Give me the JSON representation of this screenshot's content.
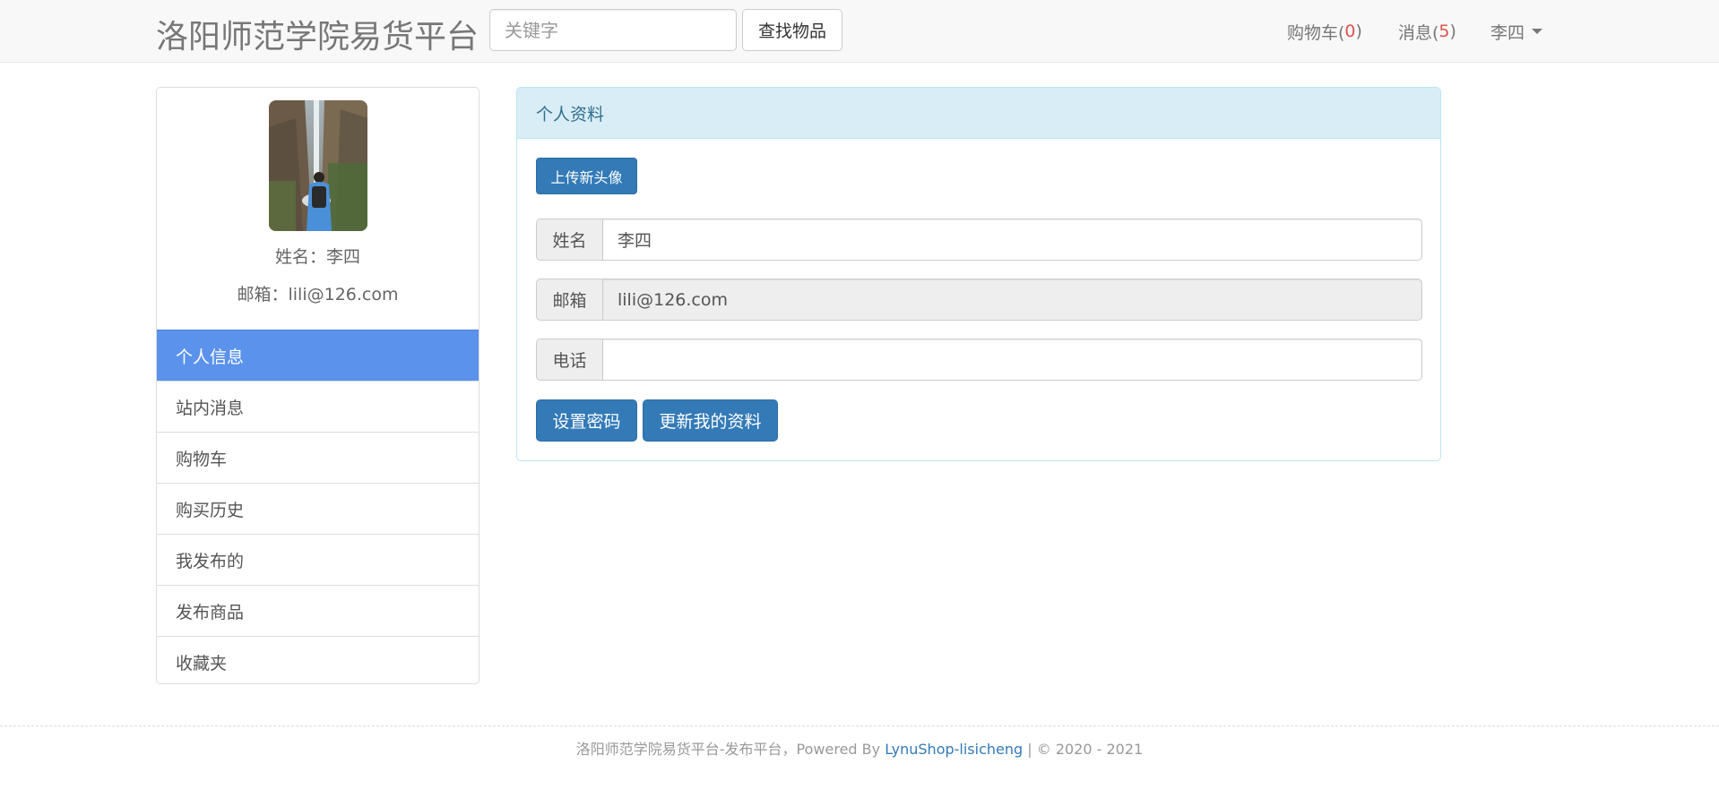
{
  "navbar": {
    "brand": "洛阳师范学院易货平台",
    "search_placeholder": "关键字",
    "search_button": "查找物品",
    "cart_label": "购物车(",
    "cart_count": "0",
    "cart_close": ")",
    "messages_label": "消息(",
    "messages_count": "5",
    "messages_close": ")",
    "user_name": "李四"
  },
  "profile": {
    "name_line": "姓名：李四",
    "email_line": "邮箱：lili@126.com"
  },
  "menu": [
    {
      "label": "个人信息",
      "active": true
    },
    {
      "label": "站内消息",
      "active": false
    },
    {
      "label": "购物车",
      "active": false
    },
    {
      "label": "购买历史",
      "active": false
    },
    {
      "label": "我发布的",
      "active": false
    },
    {
      "label": "发布商品",
      "active": false
    },
    {
      "label": "收藏夹",
      "active": false
    }
  ],
  "panel": {
    "title": "个人资料",
    "upload_button": "上传新头像",
    "name_label": "姓名",
    "name_value": "李四",
    "email_label": "邮箱",
    "email_value": "lili@126.com",
    "phone_label": "电话",
    "phone_value": "",
    "set_password_button": "设置密码",
    "update_button": "更新我的资料"
  },
  "footer": {
    "text": "洛阳师范学院易货平台-发布平台，Powered By ",
    "link": "LynuShop-lisicheng",
    "suffix": " | © 2020 - 2021"
  },
  "colors": {
    "primary": "#337ab7",
    "active_menu": "#5b92eb",
    "panel_heading_bg": "#d9edf7",
    "badge_red": "#d9534f"
  }
}
